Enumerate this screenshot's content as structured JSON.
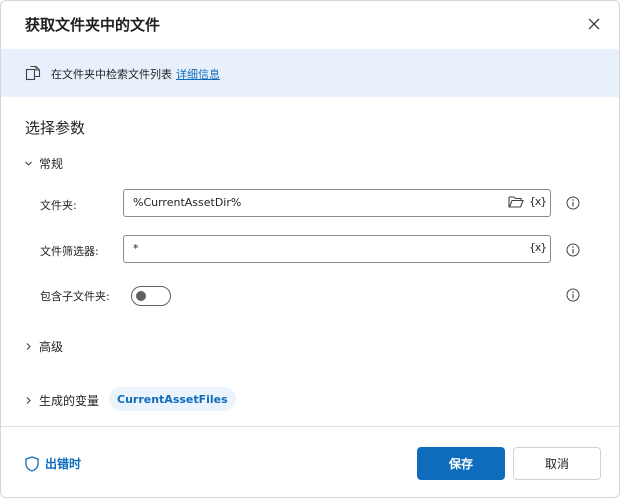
{
  "dialog": {
    "title": "获取文件夹中的文件",
    "close_icon": "close-icon"
  },
  "info_bar": {
    "icon": "file-copy-icon",
    "text": "在文件夹中检索文件列表",
    "link": "详细信息"
  },
  "section_title": "选择参数",
  "groups": {
    "general": "常规",
    "advanced": "高级",
    "variables": "生成的变量"
  },
  "fields": {
    "folder": {
      "label": "文件夹:",
      "value": "%CurrentAssetDir%",
      "var_button": "{x}"
    },
    "filter": {
      "label": "文件筛选器:",
      "value": "*",
      "var_button": "{x}"
    },
    "include_subfolders": {
      "label": "包含子文件夹:",
      "enabled": false
    }
  },
  "variables": {
    "output": "CurrentAssetFiles"
  },
  "footer": {
    "on_error": "出错时",
    "save": "保存",
    "cancel": "取消"
  },
  "colors": {
    "accent": "#0f6cbd",
    "info_bar": "#e8f1fb",
    "chip_bg": "#ebf3fc"
  }
}
